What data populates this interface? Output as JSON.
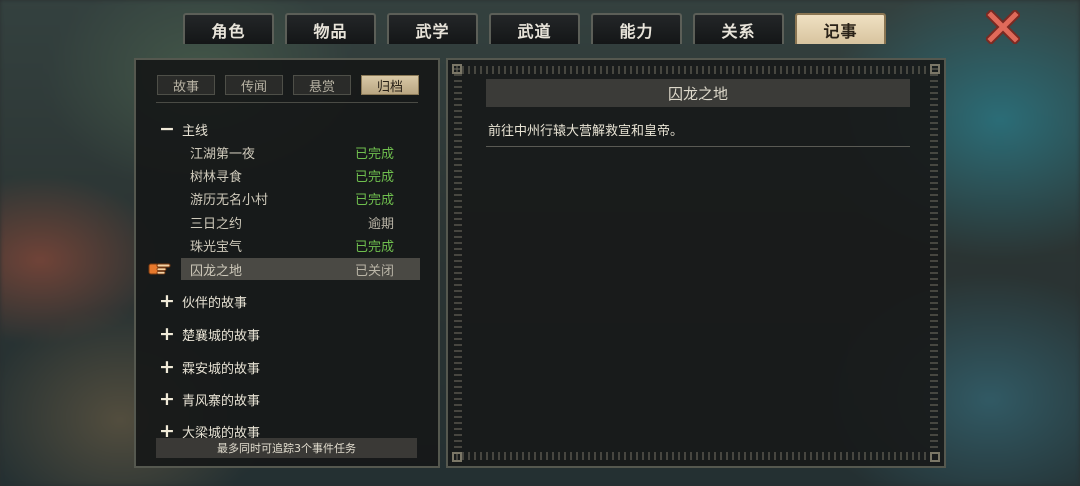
{
  "tabs": [
    {
      "label": "角色",
      "active": false
    },
    {
      "label": "物品",
      "active": false
    },
    {
      "label": "武学",
      "active": false
    },
    {
      "label": "武道",
      "active": false
    },
    {
      "label": "能力",
      "active": false
    },
    {
      "label": "关系",
      "active": false
    },
    {
      "label": "记事",
      "active": true
    }
  ],
  "subtabs": [
    {
      "label": "故事",
      "active": false
    },
    {
      "label": "传闻",
      "active": false
    },
    {
      "label": "悬赏",
      "active": false
    },
    {
      "label": "归档",
      "active": true
    }
  ],
  "groups": {
    "main": {
      "label": "主线",
      "expanded": true
    },
    "collapsed": [
      {
        "label": "伙伴的故事"
      },
      {
        "label": "楚襄城的故事"
      },
      {
        "label": "霖安城的故事"
      },
      {
        "label": "青风寨的故事"
      },
      {
        "label": "大梁城的故事"
      }
    ]
  },
  "quests": [
    {
      "name": "江湖第一夜",
      "status": "已完成",
      "done": true
    },
    {
      "name": "树林寻食",
      "status": "已完成",
      "done": true
    },
    {
      "name": "游历无名小村",
      "status": "已完成",
      "done": true
    },
    {
      "name": "三日之约",
      "status": "逾期",
      "done": false
    },
    {
      "name": "珠光宝气",
      "status": "已完成",
      "done": true
    },
    {
      "name": "囚龙之地",
      "status": "已关闭",
      "done": false,
      "selected": true
    }
  ],
  "footer": "最多同时可追踪3个事件任务",
  "detail": {
    "title": "囚龙之地",
    "description": "前往中州行辕大营解救宣和皇帝。"
  },
  "icons": {
    "close": "close-x-icon",
    "pointer": "hand-pointer-icon",
    "expand": "plus-icon",
    "collapse": "minus-icon"
  },
  "colors": {
    "done": "#6fbf4e",
    "active_tab": "#e3d2b0",
    "close": "#e06a5a"
  }
}
